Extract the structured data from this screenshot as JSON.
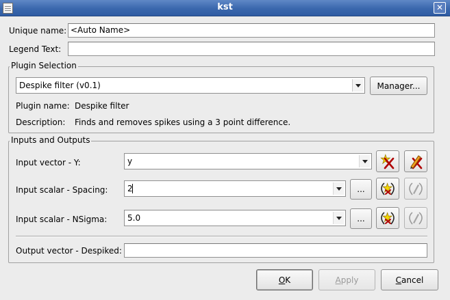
{
  "window": {
    "title": "kst"
  },
  "fields": {
    "unique_name": {
      "label": "Unique name:",
      "value": "<Auto Name>"
    },
    "legend_text": {
      "label": "Legend Text:",
      "value": ""
    }
  },
  "plugin_selection": {
    "group_title": "Plugin Selection",
    "selected_plugin": "Despike filter (v0.1)",
    "manager_label": "Manager...",
    "plugin_name_label": "Plugin name:",
    "plugin_name_value": "Despike filter",
    "description_label": "Description:",
    "description_value": "Finds and removes spikes using a 3 point difference."
  },
  "inputs_outputs": {
    "group_title": "Inputs and Outputs",
    "input_vector_y": {
      "label": "Input vector - Y:",
      "value": "y"
    },
    "input_scalar_spacing": {
      "label": "Input scalar - Spacing:",
      "value": "2"
    },
    "input_scalar_nsigma": {
      "label": "Input scalar - NSigma:",
      "value": "5.0"
    },
    "output_vector": {
      "label": "Output vector - Despiked:",
      "value": ""
    },
    "browse_label": "..."
  },
  "buttons": {
    "ok": {
      "mnemonic": "O",
      "rest": "K"
    },
    "apply": {
      "mnemonic": "A",
      "rest": "pply"
    },
    "cancel": {
      "mnemonic": "C",
      "rest": "ancel"
    }
  }
}
